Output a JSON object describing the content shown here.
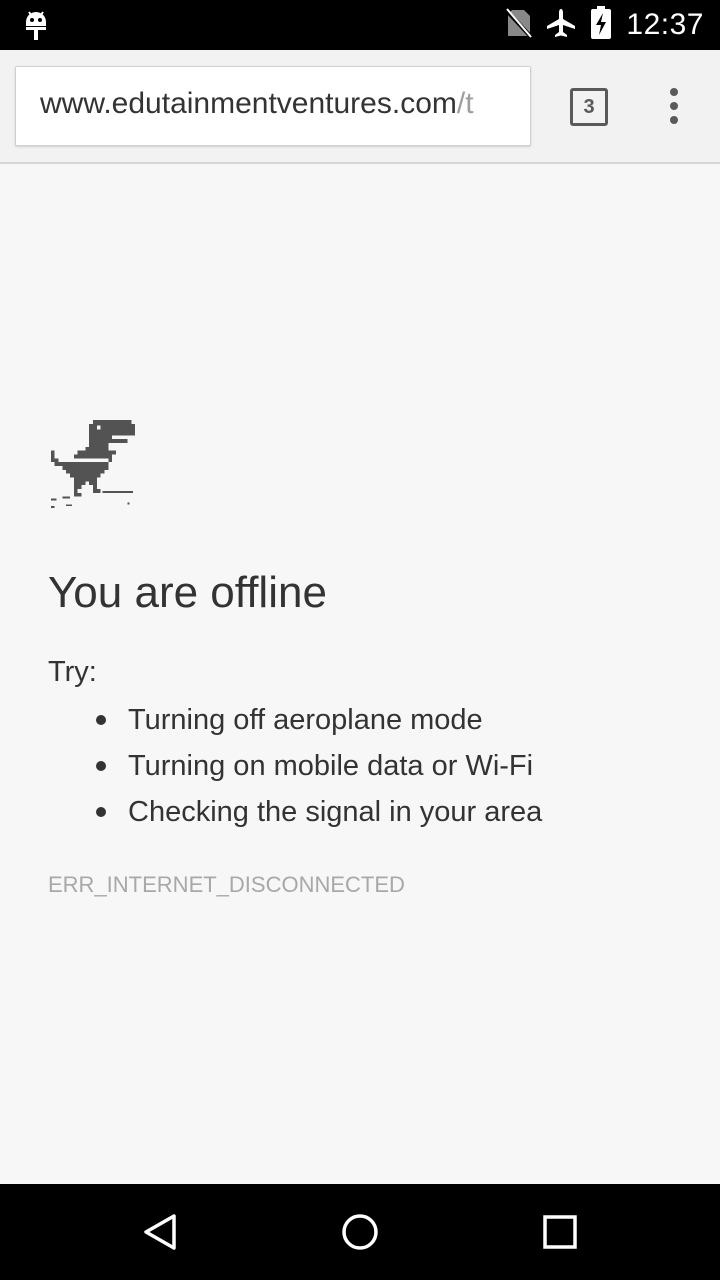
{
  "status_bar": {
    "time": "12:37",
    "icons": [
      "android-notification-icon",
      "no-sim-icon",
      "airplane-mode-icon",
      "battery-charging-icon"
    ]
  },
  "toolbar": {
    "url_host": "www.edutainmentventures.com",
    "url_path": "/t",
    "tab_count": "3",
    "menu_icon": "more-vert-icon"
  },
  "page": {
    "title": "You are offline",
    "try_label": "Try:",
    "suggestions": [
      "Turning off aeroplane mode",
      "Turning on mobile data or Wi-Fi",
      "Checking the signal in your area"
    ],
    "error_code": "ERR_INTERNET_DISCONNECTED"
  },
  "nav_bar": {
    "icons": [
      "back-icon",
      "home-icon",
      "recents-icon"
    ]
  },
  "colors": {
    "background": "#f7f7f7",
    "text": "#333333",
    "muted": "#a8a8a8",
    "bars": "#000000"
  }
}
